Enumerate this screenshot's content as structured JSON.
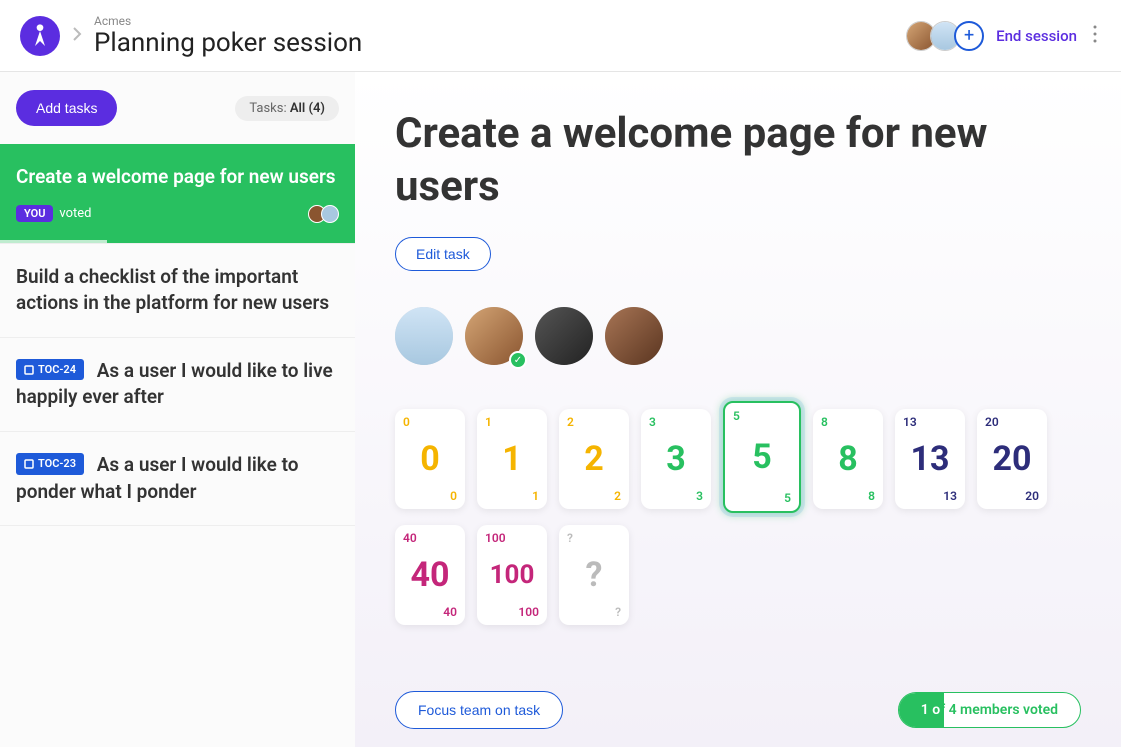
{
  "header": {
    "breadcrumb": "Acmes",
    "title": "Planning poker session",
    "end_session": "End session"
  },
  "sidebar": {
    "add_tasks": "Add tasks",
    "filter_prefix": "Tasks: ",
    "filter_value": "All (4)",
    "tasks": [
      {
        "title": "Create a welcome page for new users",
        "you_label": "YOU",
        "voted_label": "voted",
        "active": true
      },
      {
        "title": "Build a checklist of the important actions in the platform for new users"
      },
      {
        "toc": "TOC-24",
        "title": "As a user I would like to live happily ever after"
      },
      {
        "toc": "TOC-23",
        "title": "As a user I would like to ponder what I ponder"
      }
    ]
  },
  "main": {
    "title": "Create a welcome page for new users",
    "edit_task": "Edit task",
    "focus_btn": "Focus team on task",
    "voted_status_a": "1 o",
    "voted_status_b": "f 4 members voted"
  },
  "cards": [
    {
      "v": "0",
      "color": "#f5b400"
    },
    {
      "v": "1",
      "color": "#f5b400"
    },
    {
      "v": "2",
      "color": "#f5b400"
    },
    {
      "v": "3",
      "color": "#28c060"
    },
    {
      "v": "5",
      "color": "#28c060",
      "selected": true
    },
    {
      "v": "8",
      "color": "#28c060"
    },
    {
      "v": "13",
      "color": "#2d2d7a"
    },
    {
      "v": "20",
      "color": "#2d2d7a"
    },
    {
      "v": "40",
      "color": "#c4267a"
    },
    {
      "v": "100",
      "color": "#c4267a",
      "sm": true
    },
    {
      "v": "?",
      "color": "#bbb"
    }
  ]
}
